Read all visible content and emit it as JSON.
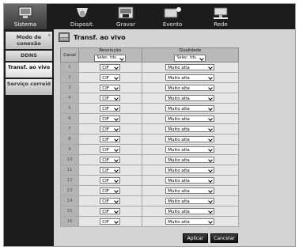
{
  "nav": {
    "tabs": [
      {
        "label": "Sistema",
        "icon": "monitor-icon",
        "active": true
      },
      {
        "label": "Disposit.",
        "icon": "camera-icon",
        "active": false
      },
      {
        "label": "Gravar",
        "icon": "record-icon",
        "active": false
      },
      {
        "label": "Evento",
        "icon": "event-icon",
        "active": false
      },
      {
        "label": "Rede",
        "icon": "network-icon",
        "active": false
      }
    ]
  },
  "sidebar": {
    "items": [
      {
        "label": "Modo de conexão",
        "active": false
      },
      {
        "label": "DDNS",
        "active": false
      },
      {
        "label": "Transf. ao vivo",
        "active": true
      },
      {
        "label": "Serviço correio",
        "active": false
      }
    ]
  },
  "page": {
    "title": "Transf. ao vivo"
  },
  "table": {
    "headers": {
      "channel": "Canal",
      "resolution": "Resolução",
      "quality": "Qualidade"
    },
    "select_all": {
      "resolution": "Selec. tds.",
      "quality": "Selec. tds."
    },
    "rows": [
      {
        "channel": "1",
        "resolution": "CIF",
        "quality": "Muito alta"
      },
      {
        "channel": "2",
        "resolution": "CIF",
        "quality": "Muito alta"
      },
      {
        "channel": "3",
        "resolution": "CIF",
        "quality": "Muito alta"
      },
      {
        "channel": "4",
        "resolution": "CIF",
        "quality": "Muito alta"
      },
      {
        "channel": "5",
        "resolution": "CIF",
        "quality": "Muito alta"
      },
      {
        "channel": "6",
        "resolution": "CIF",
        "quality": "Muito alta"
      },
      {
        "channel": "7",
        "resolution": "CIF",
        "quality": "Muito alta"
      },
      {
        "channel": "8",
        "resolution": "CIF",
        "quality": "Muito alta"
      },
      {
        "channel": "9",
        "resolution": "CIF",
        "quality": "Muito alta"
      },
      {
        "channel": "10",
        "resolution": "CIF",
        "quality": "Muito alta"
      },
      {
        "channel": "11",
        "resolution": "CIF",
        "quality": "Muito alta"
      },
      {
        "channel": "12",
        "resolution": "CIF",
        "quality": "Muito alta"
      },
      {
        "channel": "13",
        "resolution": "CIF",
        "quality": "Muito alta"
      },
      {
        "channel": "14",
        "resolution": "CIF",
        "quality": "Muito alta"
      },
      {
        "channel": "15",
        "resolution": "CIF",
        "quality": "Muito alta"
      },
      {
        "channel": "16",
        "resolution": "CIF",
        "quality": "Muito alta"
      }
    ]
  },
  "buttons": {
    "apply": "Aplicar",
    "cancel": "Cancelar"
  }
}
